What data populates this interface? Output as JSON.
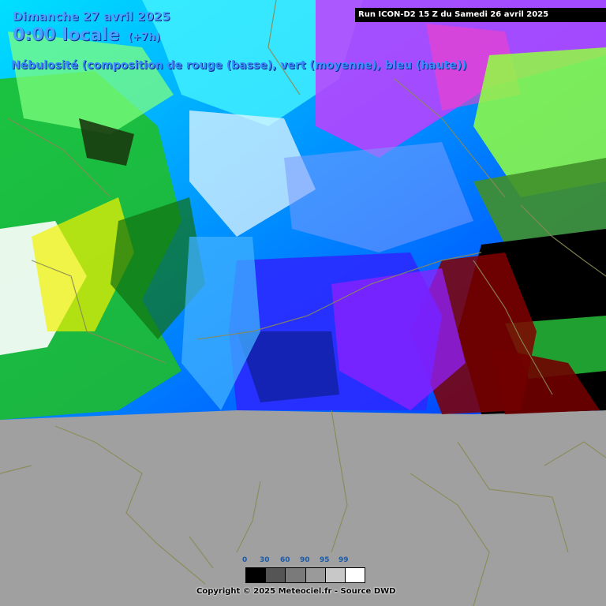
{
  "header": {
    "date": "Dimanche 27 avril 2025",
    "time": "0:00 locale",
    "offset": "(+7h)",
    "parameter": "Nébulosité (composition de rouge (basse), vert (moyenne), bleu (haute))"
  },
  "run": {
    "label": "Run ICON-D2 15 Z du Samedi 26 avril 2025"
  },
  "legend": {
    "ticks": [
      "0",
      "30",
      "60",
      "90",
      "95",
      "99"
    ],
    "swatch_colors": [
      "#000000",
      "#555555",
      "#7a7a7a",
      "#9a9a9a",
      "#c8c8c8",
      "#ffffff"
    ]
  },
  "footer": {
    "copyright": "Copyright © 2025 Meteociel.fr - Source DWD"
  },
  "colors": {
    "no_data": "#a0a0a0",
    "border_lines": "#8a8a55",
    "title_text": "#4aa0ff"
  }
}
